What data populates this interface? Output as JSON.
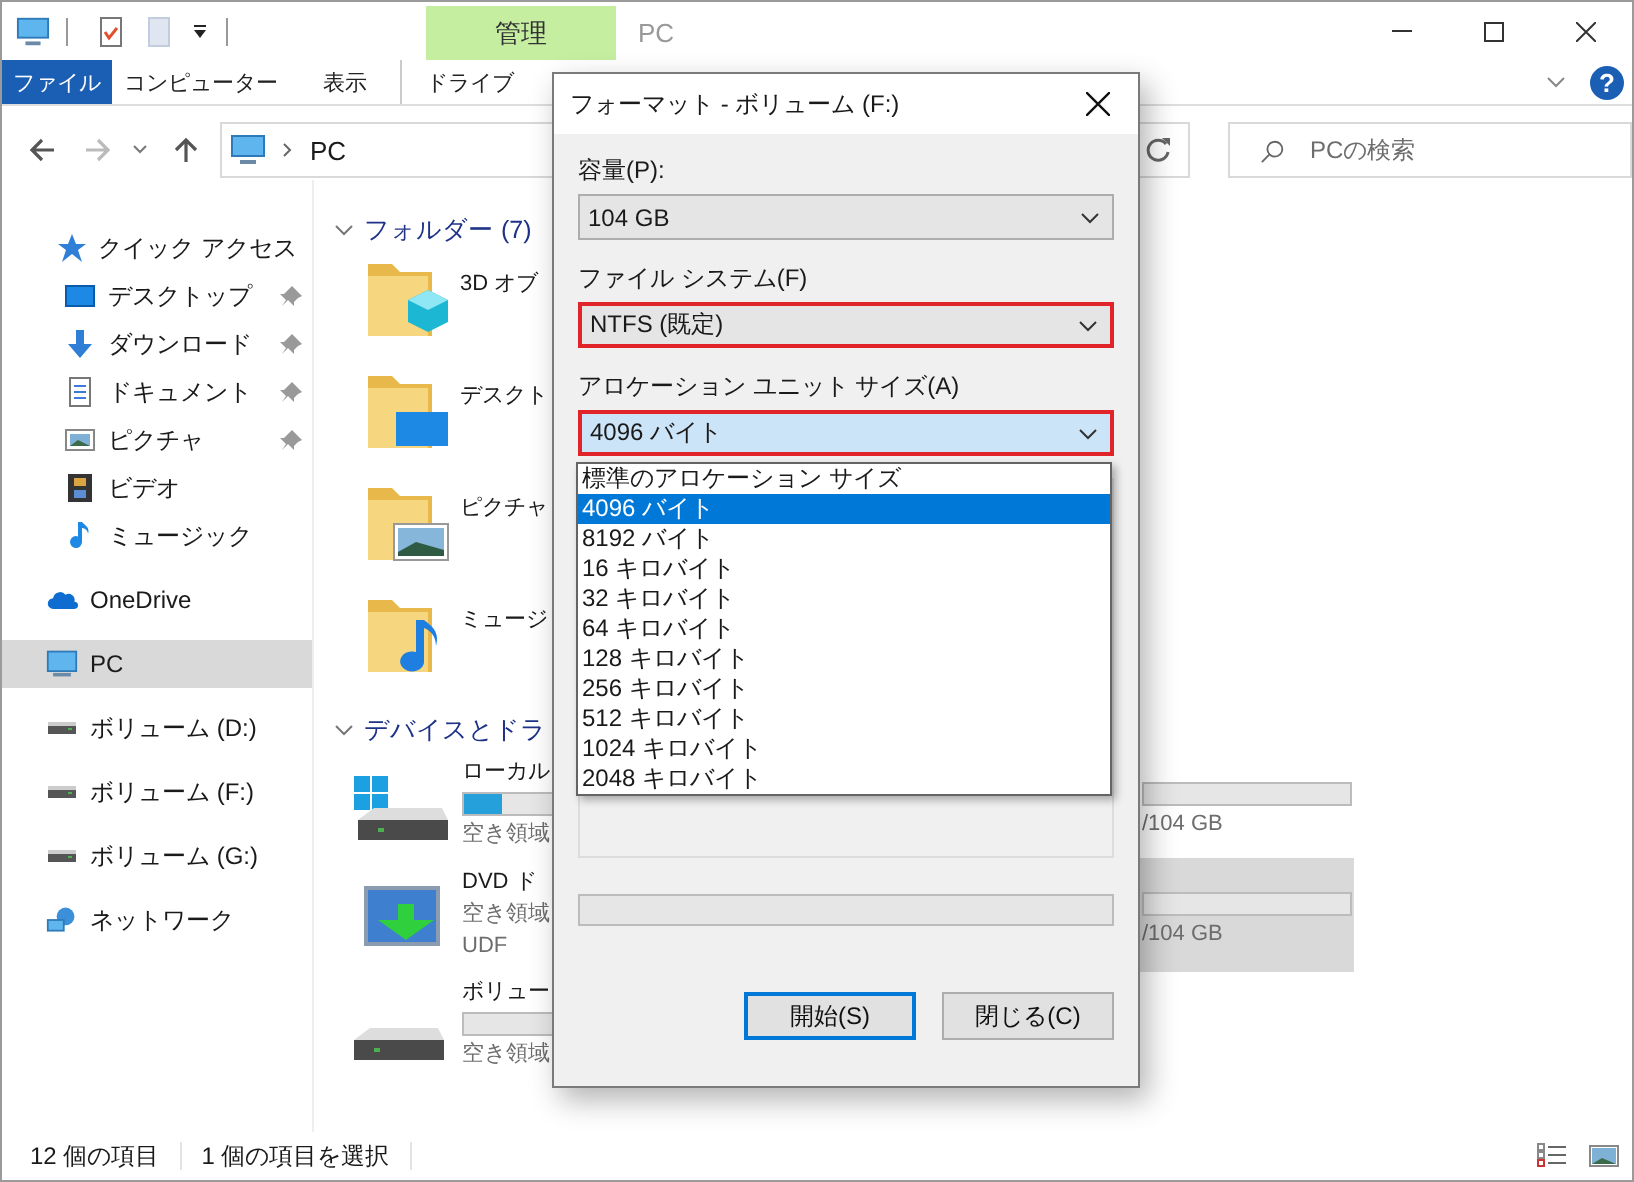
{
  "window": {
    "context_tab": "管理",
    "title": "PC",
    "help_glyph": "?"
  },
  "ribbon_tabs": [
    {
      "label": "ファイル",
      "kind": "file"
    },
    {
      "label": "コンピューター",
      "kind": "plain"
    },
    {
      "label": "表示",
      "kind": "plain"
    },
    {
      "label": "ドライブ",
      "kind": "context"
    }
  ],
  "address": {
    "path": "PC"
  },
  "search": {
    "placeholder": "PCの検索"
  },
  "nav": [
    {
      "label": "クイック アクセス",
      "kind": "quick",
      "selected": false,
      "children": [
        {
          "label": "デスクトップ",
          "kind": "desktop",
          "pinned": true,
          "selected": false
        },
        {
          "label": "ダウンロード",
          "kind": "download",
          "pinned": true,
          "selected": false
        },
        {
          "label": "ドキュメント",
          "kind": "document",
          "pinned": true,
          "selected": false
        },
        {
          "label": "ピクチャ",
          "kind": "picture",
          "pinned": true,
          "selected": false
        },
        {
          "label": "ビデオ",
          "kind": "video",
          "pinned": false,
          "selected": false
        },
        {
          "label": "ミュージック",
          "kind": "music",
          "pinned": false,
          "selected": false
        }
      ]
    },
    {
      "label": "OneDrive",
      "kind": "cloud",
      "selected": false
    },
    {
      "label": "PC",
      "kind": "pc",
      "selected": true
    },
    {
      "label": "ボリューム (D:)",
      "kind": "drive",
      "selected": false
    },
    {
      "label": "ボリューム (F:)",
      "kind": "drive",
      "selected": false
    },
    {
      "label": "ボリューム (G:)",
      "kind": "drive",
      "selected": false
    },
    {
      "label": "ネットワーク",
      "kind": "network",
      "selected": false
    }
  ],
  "folders": {
    "title": "フォルダー (7)",
    "items": [
      {
        "name": "3D オブ",
        "kind": "cube"
      },
      {
        "name": "デスクト",
        "kind": "desktop"
      },
      {
        "name": "ピクチャ",
        "kind": "picture"
      },
      {
        "name": "ミュージ",
        "kind": "music"
      }
    ]
  },
  "devices": {
    "title": "デバイスとドラ",
    "items": [
      {
        "name": "ローカル",
        "kind": "system",
        "level": 0.13,
        "lines": [
          "空き領域"
        ]
      },
      {
        "name": "DVD ド",
        "kind": "dvd",
        "lines": [
          "空き領域",
          "UDF"
        ]
      },
      {
        "name": "ボリュー",
        "kind": "drive",
        "level": 0,
        "lines": [
          "空き領域"
        ]
      }
    ],
    "column_2": [
      {
        "size": "/104 GB",
        "selected": false
      },
      {
        "size": "/104 GB",
        "selected": true
      }
    ]
  },
  "status_bar": {
    "count": "12 個の項目",
    "selection": "1 個の項目を選択"
  },
  "dialog": {
    "title": "フォーマット - ボリューム (F:)",
    "fields": [
      {
        "label": "容量(P):",
        "value": "104 GB",
        "highlighted": false,
        "open": false
      },
      {
        "label": "ファイル システム(F)",
        "value": "NTFS (既定)",
        "highlighted": true,
        "open": false
      },
      {
        "label": "アロケーション ユニット サイズ(A)",
        "value": "4096 バイト",
        "highlighted": true,
        "open": true
      }
    ],
    "options": [
      {
        "label": "標準のアロケーション サイズ",
        "selected": false
      },
      {
        "label": "4096 バイト",
        "selected": true
      },
      {
        "label": "8192 バイト",
        "selected": false
      },
      {
        "label": "16 キロバイト",
        "selected": false
      },
      {
        "label": "32 キロバイト",
        "selected": false
      },
      {
        "label": "64 キロバイト",
        "selected": false
      },
      {
        "label": "128 キロバイト",
        "selected": false
      },
      {
        "label": "256 キロバイト",
        "selected": false
      },
      {
        "label": "512 キロバイト",
        "selected": false
      },
      {
        "label": "1024 キロバイト",
        "selected": false
      },
      {
        "label": "2048 キロバイト",
        "selected": false
      }
    ],
    "progress": {
      "level": 0
    },
    "buttons": [
      {
        "label": "開始(S)",
        "default": true
      },
      {
        "label": "閉じる(C)",
        "default": false
      }
    ]
  }
}
